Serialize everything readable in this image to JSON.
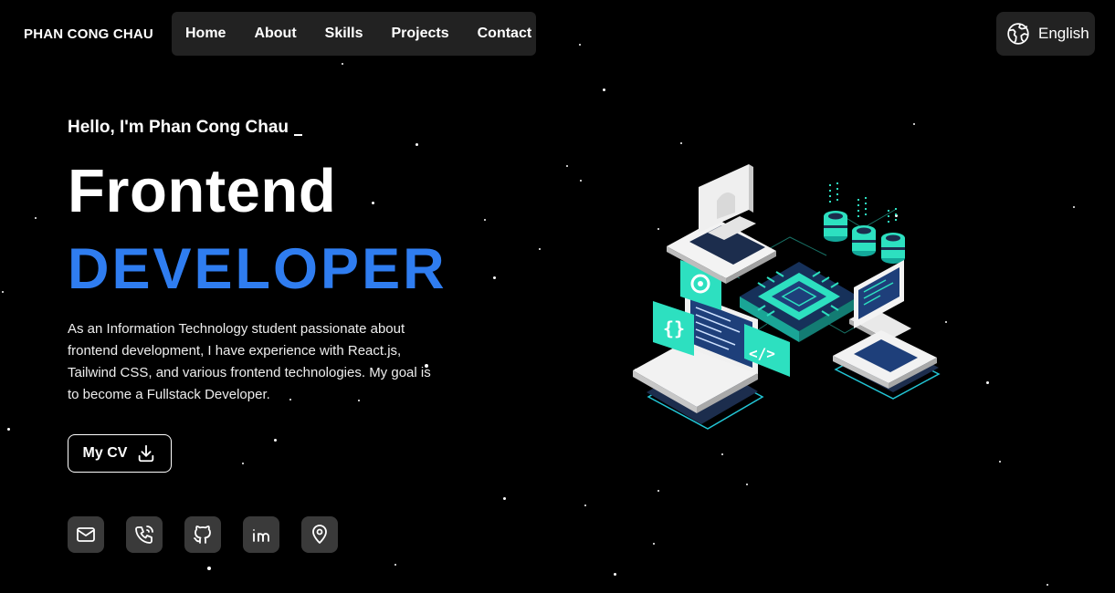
{
  "brand": "PHAN CONG CHAU",
  "nav": [
    "Home",
    "About",
    "Skills",
    "Projects",
    "Contact"
  ],
  "language": {
    "label": "English",
    "icon": "globe-icon"
  },
  "hero": {
    "greeting": "Hello, I'm Phan Cong Chau",
    "title_line1": "Frontend",
    "title_line2": "DEVELOPER",
    "description": "As an Information Technology student passionate about frontend development, I have experience with React.js, Tailwind CSS, and various frontend technologies. My goal is to become a Fullstack Developer.",
    "cv_button": "My CV"
  },
  "socials": [
    "mail-icon",
    "phone-icon",
    "github-icon",
    "linkedin-icon",
    "location-icon"
  ],
  "colors": {
    "accent": "#2f7df0",
    "background": "#000000",
    "panel": "#222222",
    "social_bg": "#3a3a3a",
    "teal": "#2de0c0"
  }
}
